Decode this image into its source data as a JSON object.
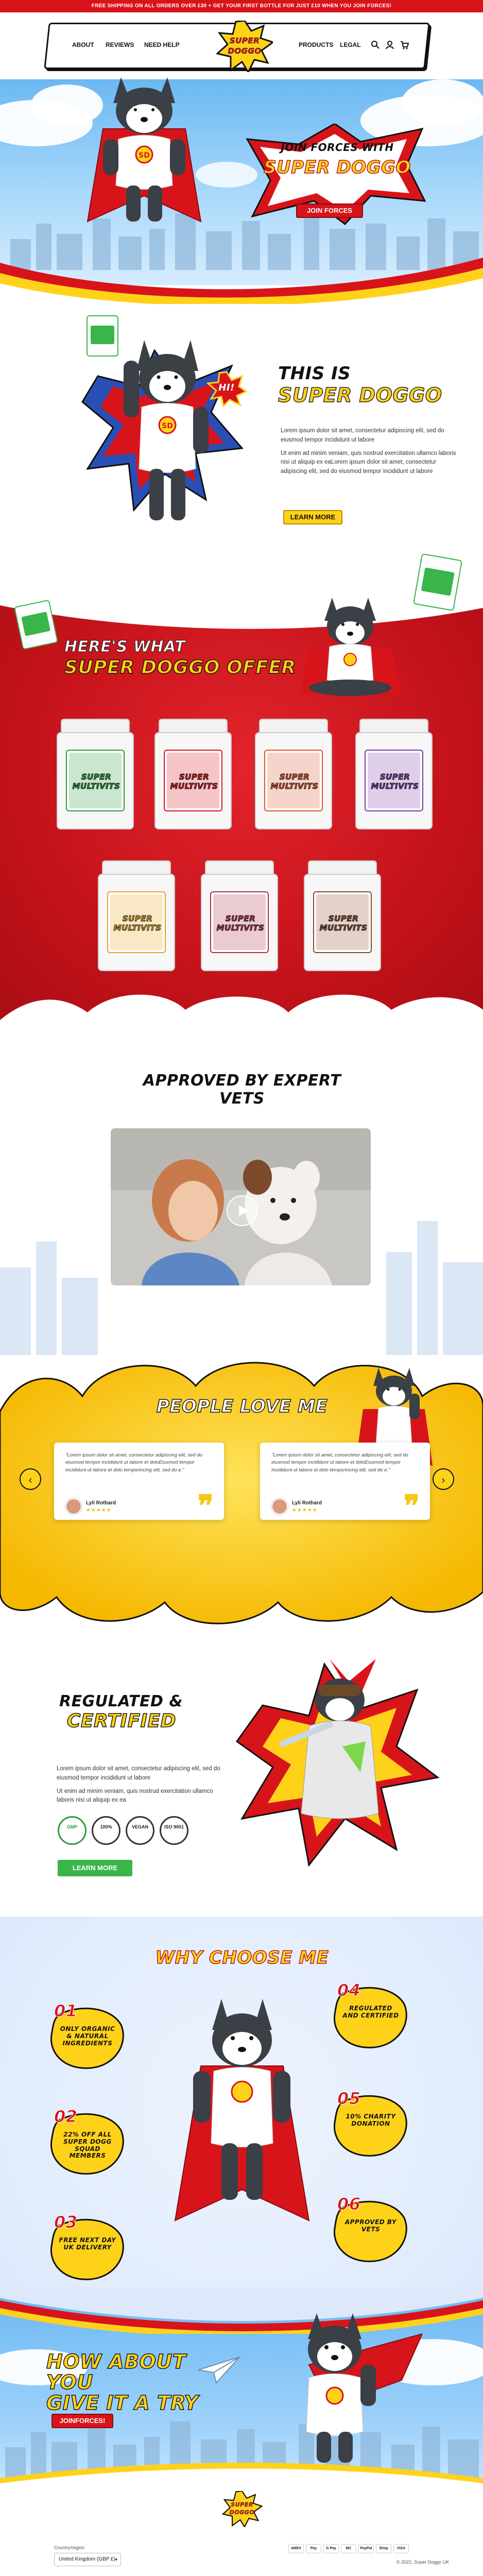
{
  "announcement": "FREE SHIPPING ON ALL ORDERS OVER £30 + GET YOUR FIRST BOTTLE FOR JUST £10 WHEN YOU JOIN FORCES!",
  "nav": {
    "left": [
      "ABOUT",
      "REVIEWS",
      "NEED HELP"
    ],
    "right": [
      "PRODUCTS",
      "LEGAL"
    ],
    "logo_line1": "SUPER",
    "logo_line2": "DOGGO"
  },
  "hero": {
    "title_line1": "JOIN FORCES WITH",
    "title_line2": "SUPER DOGGO",
    "button": "JOIN FORCES"
  },
  "intro": {
    "title_line1": "THIS IS",
    "title_line2": "SUPER DOGGO",
    "hi_bubble": "HI!",
    "paragraph1": "Lorem ipsum dolor sit amet, consectetur adipiscing elit, sed do eiusmod tempor incididunt ut labore",
    "paragraph2": "Ut enim ad minim veniam, quis nostrud exercitation ullamco laboris nisi ut aliquip ex eaLorem ipsum dolor sit amet, consectetur adipiscing elit, sed do eiusmod tempor incididunt ut labore",
    "button": "LEARN MORE"
  },
  "offer": {
    "title_line1": "HERE'S WHAT",
    "title_line2": "SUPER DOGGO OFFER",
    "products": [
      {
        "line1": "SUPER",
        "line2": "MULTIVITS",
        "color": "#2a9d3a"
      },
      {
        "line1": "SUPER",
        "line2": "MULTIVITS",
        "color": "#d8141b"
      },
      {
        "line1": "SUPER",
        "line2": "MULTIVITS",
        "color": "#e0532a"
      },
      {
        "line1": "SUPER",
        "line2": "MULTIVITS",
        "color": "#7a3ba8"
      },
      {
        "line1": "SUPER",
        "line2": "MULTIVITS",
        "color": "#e7a21c"
      },
      {
        "line1": "SUPER",
        "line2": "MULTIVITS",
        "color": "#b0304a"
      },
      {
        "line1": "SUPER",
        "line2": "MULTIVITS",
        "color": "#8a4a2a"
      }
    ]
  },
  "vets": {
    "title": "APPROVED BY EXPERT VETS"
  },
  "love": {
    "title": "PEOPLE LOVE ME",
    "reviews": [
      {
        "quote": "\"Lorem ipsum dolor sit amet, consectetur adipiscing elit, sed do eiusmod tempor incididunt ut labore et doloEiusmod tempor incididunt ut labore et dolo temporincing elit, sed do e.\"",
        "name": "Lyli Rothard",
        "stars": "★★★★★"
      },
      {
        "quote": "\"Lorem ipsum dolor sit amet, consectetur adipiscing elit, sed do eiusmod tempor incididunt ut labore et doloEiusmod tempor incididunt ut labore et dolo temporincing elit, sed do e.\"",
        "name": "Lyli Rothard",
        "stars": "★★★★★"
      }
    ]
  },
  "certified": {
    "title_line1": "REGULATED &",
    "title_line2": "CERTIFIED",
    "paragraph1": "Lorem ipsum dolor sit amet, consectetur adipiscing elit, sed do eiusmod tempor incididunt ut labore",
    "paragraph2": "Ut enim ad minim veniam, quis nostrud exercitation ullamco laboris nisi ut aliquip ex ea",
    "badges": [
      "GMP",
      "100%",
      "VEGAN",
      "ISO 9001"
    ],
    "button": "LEARN MORE"
  },
  "why": {
    "title": "WHY CHOOSE ME",
    "items": [
      {
        "num": "01",
        "text": "ONLY ORGANIC & NATURAL INGREDIENTS"
      },
      {
        "num": "02",
        "text": "22% OFF ALL SUPER DOGG SQUAD MEMBERS"
      },
      {
        "num": "03",
        "text": "FREE NEXT DAY UK DELIVERY"
      },
      {
        "num": "04",
        "text": "REGULATED AND CERTIFIED"
      },
      {
        "num": "05",
        "text": "10% CHARITY DONATION"
      },
      {
        "num": "06",
        "text": "APPROVED BY VETS"
      }
    ]
  },
  "final": {
    "title_line1": "HOW ABOUT YOU",
    "title_line2": "GIVE IT A TRY",
    "button": "JOINFORCES!"
  },
  "footer": {
    "country_label": "Country/region",
    "country_value": "United Kingdom (GBP £)",
    "payments": [
      "AMEX",
      "Pay",
      "G Pay",
      "MC",
      "PayPal",
      "Shop",
      "VISA"
    ],
    "copyright": "© 2022, Super Doggo UK"
  },
  "colors": {
    "brand_red": "#d8141b",
    "brand_yellow": "#ffd21a",
    "sky_blue": "#6bb8f2",
    "green": "#39b54a"
  }
}
